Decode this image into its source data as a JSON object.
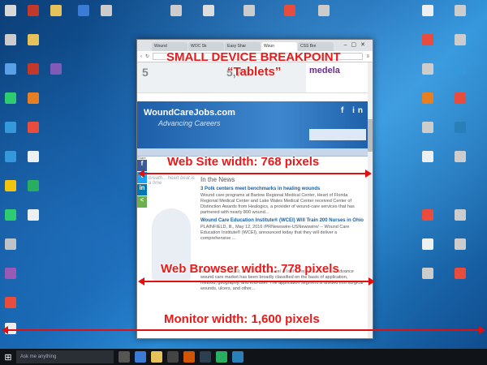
{
  "annotations": {
    "title_line1": "SMALL DEVICE BREAKPOINT",
    "title_line2": "“Tablets”",
    "website_width": "Web Site width:  768 pixels",
    "browser_width": "Web Browser width: 778 pixels",
    "monitor_width": "Monitor width: 1,600 pixels"
  },
  "browser": {
    "tabs": [
      "Wound",
      "WOC Sk",
      "Easy Shar",
      "Woun",
      "CSS Bre"
    ]
  },
  "site": {
    "stats": [
      "5",
      "5,76"
    ],
    "sponsor": "medela",
    "logo": "WoundCareJobs.com",
    "logo_sub": "Advancing Careers",
    "social": "f  in",
    "share_label": "Share",
    "side_text": "breath... heart beat is a time",
    "news_heading": "In the News",
    "news": [
      {
        "title": "3 Polk centers meet benchmarks in healing wounds",
        "body": "Wound care programs at Bartow Regional Medical Center, Heart of Florida Regional Medical Center and Lake Wales Medical Center received Center of Distinction Awards from Healogics, a provider of wound-care services that has partnered with nearly 800 wound..."
      },
      {
        "title": "Wound Care Education Institute® (WCEI) Will Train 200 Nurses in Ohio",
        "body": "PLAINFIELD, Ill., May 12, 2016 /PRNewswire-USNewswire/ -- Wound Care Education Institute® (WCEI), announced today that they will deliver a comprehensive ..."
      },
      {
        "title": "",
        "body": "NEW YORK, May 9, 2016 /PRNewswire/ -- In this report, the Europe advance wound care market has been broadly classified on the basis of application, method, geography, and end-user. The application segment is divided into surgical wounds, ulcers, and other..."
      }
    ]
  },
  "taskbar": {
    "search_placeholder": "Ask me anything"
  }
}
